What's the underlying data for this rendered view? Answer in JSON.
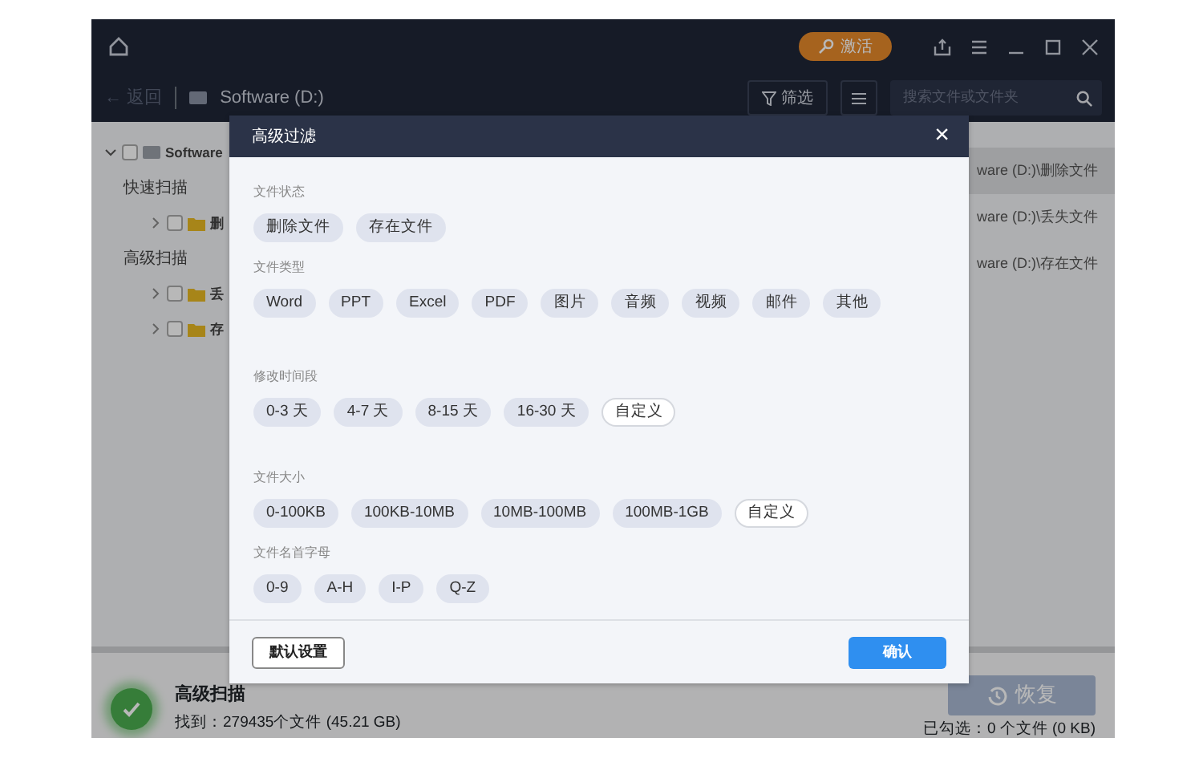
{
  "title_bar": {
    "activate_button": "激活"
  },
  "toolbar": {
    "back": {
      "label": "← 返回",
      "disabled": true
    },
    "path": "Software (D:)",
    "filter_button": "筛选",
    "search": {
      "placeholder": "搜索文件或文件夹"
    }
  },
  "tree": [
    {
      "label": "Software",
      "kind": "drive",
      "expanded": true,
      "checked": false
    },
    {
      "label": "快速扫描",
      "kind": "heading"
    },
    {
      "label": "删",
      "kind": "folder",
      "expanded": false,
      "checked": false
    },
    {
      "label": "高级扫描",
      "kind": "heading"
    },
    {
      "label": "丢",
      "kind": "folder",
      "expanded": false,
      "checked": false
    },
    {
      "label": "存",
      "kind": "folder",
      "expanded": false,
      "checked": false
    }
  ],
  "results": [
    {
      "path": "ware (D:)\\删除文件",
      "selected": true
    },
    {
      "path": "ware (D:)\\丢失文件",
      "selected": false
    },
    {
      "path": "ware (D:)\\存在文件",
      "selected": false
    }
  ],
  "status": {
    "title": "高级扫描",
    "found": "找到：279435个文件 (45.21 GB)",
    "restore_button": {
      "label": "恢复",
      "disabled": true
    },
    "checked": "已勾选：0 个文件 (0 KB)"
  },
  "dialog": {
    "title": "高级过滤",
    "close": "×",
    "sections": [
      {
        "label": "文件状态",
        "options": [
          {
            "label": "删除文件",
            "kind": "option"
          },
          {
            "label": "存在文件",
            "kind": "option"
          }
        ]
      },
      {
        "label": "文件类型",
        "options": [
          {
            "label": "Word",
            "kind": "option"
          },
          {
            "label": "PPT",
            "kind": "option"
          },
          {
            "label": "Excel",
            "kind": "option"
          },
          {
            "label": "PDF",
            "kind": "option"
          },
          {
            "label": "图片",
            "kind": "option"
          },
          {
            "label": "音频",
            "kind": "option"
          },
          {
            "label": "视频",
            "kind": "option"
          },
          {
            "label": "邮件",
            "kind": "option"
          },
          {
            "label": "其他",
            "kind": "option"
          }
        ]
      },
      {
        "label": "修改时间段",
        "options": [
          {
            "label": "0-3 天",
            "kind": "option"
          },
          {
            "label": "4-7 天",
            "kind": "option"
          },
          {
            "label": "8-15 天",
            "kind": "option"
          },
          {
            "label": "16-30 天",
            "kind": "option"
          },
          {
            "label": "自定义",
            "kind": "custom"
          }
        ]
      },
      {
        "label": "文件大小",
        "options": [
          {
            "label": "0-100KB",
            "kind": "option"
          },
          {
            "label": "100KB-10MB",
            "kind": "option"
          },
          {
            "label": "10MB-100MB",
            "kind": "option"
          },
          {
            "label": "100MB-1GB",
            "kind": "option"
          },
          {
            "label": "自定义",
            "kind": "custom"
          }
        ]
      },
      {
        "label": "文件名首字母",
        "options": [
          {
            "label": "0-9",
            "kind": "option"
          },
          {
            "label": "A-H",
            "kind": "option"
          },
          {
            "label": "I-P",
            "kind": "option"
          },
          {
            "label": "Q-Z",
            "kind": "option"
          }
        ]
      }
    ],
    "reset_button": "默认设置",
    "confirm_button": "确认"
  }
}
